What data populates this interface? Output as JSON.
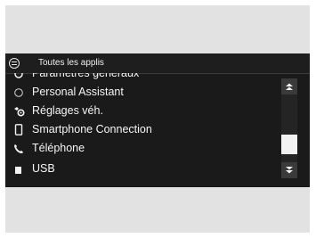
{
  "header": {
    "title": "Toutes les applis",
    "icon": "apps-menu-icon"
  },
  "list": {
    "items": [
      {
        "label": "Paramètres généraux",
        "icon": "gear-icon"
      },
      {
        "label": "Personal Assistant",
        "icon": "assistant-ring-icon"
      },
      {
        "label": "Réglages véh.",
        "icon": "vehicle-settings-icon"
      },
      {
        "label": "Smartphone Connection",
        "icon": "smartphone-icon"
      },
      {
        "label": "Téléphone",
        "icon": "phone-icon"
      },
      {
        "label": "USB",
        "icon": "usb-icon"
      }
    ]
  },
  "scrollbar": {
    "up_icon": "double-chevron-up-icon",
    "down_icon": "double-chevron-down-icon",
    "position": 0.65
  },
  "colors": {
    "screen_bg": "#1a1a1a",
    "text": "#f5f5f5",
    "frame_gray": "#e2e2e2"
  }
}
